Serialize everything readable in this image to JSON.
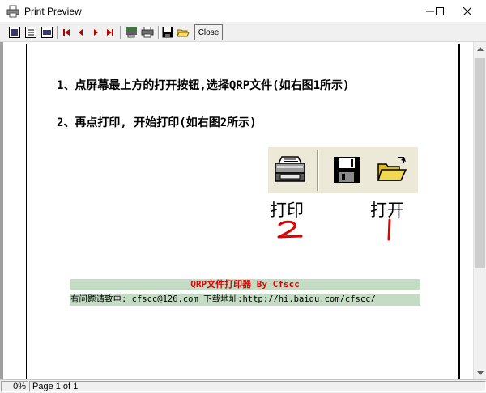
{
  "window": {
    "title": "Print Preview",
    "controls": [
      "minimize",
      "maximize",
      "close"
    ]
  },
  "toolbar": {
    "buttons": [
      {
        "name": "zoom-fit-icon"
      },
      {
        "name": "zoom-100-icon"
      },
      {
        "name": "zoom-width-icon"
      },
      {
        "name": "first-page-icon"
      },
      {
        "name": "prev-page-icon"
      },
      {
        "name": "next-page-icon"
      },
      {
        "name": "last-page-icon"
      },
      {
        "name": "printer-setup-icon"
      },
      {
        "name": "print-icon"
      },
      {
        "name": "save-icon"
      },
      {
        "name": "open-folder-icon"
      }
    ],
    "close_label": "Close"
  },
  "page": {
    "line1": "1、点屏幕最上方的打开按钮,选择QRP文件(如右图1所示)",
    "line2": "2、再点打印, 开始打印(如右图2所示)",
    "label_print": "打印",
    "label_open": "打开",
    "annotation_print": "2",
    "annotation_open": "1",
    "annotation_color": "#e00000",
    "footer_title": "QRP文件打印器 By Cfscc",
    "footer_contact": "有问题请致电: cfscc@126.com    下载地址:http://hi.baidu.com/cfscc/",
    "footer_bg": "#c3dcc3"
  },
  "status": {
    "zoom": "0%",
    "page": "Page 1 of 1"
  }
}
